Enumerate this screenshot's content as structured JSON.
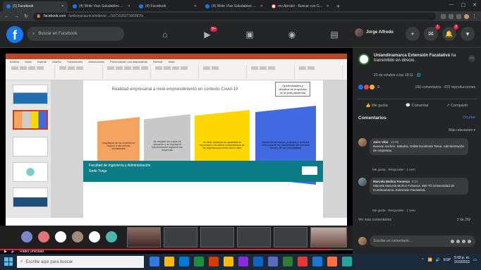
{
  "browser": {
    "tabs": [
      {
        "label": "(1) Facebook",
        "active": true
      },
      {
        "label": "(4) Write Vías Saludables Fa...",
        "active": false
      },
      {
        "label": "(4) Facebook",
        "active": false
      },
      {
        "label": "(4) Write Vías Saludables Fa...",
        "active": false
      },
      {
        "label": "rev.Aprobó - Buscar con Google",
        "active": false
      }
    ],
    "url_host": "facebook.com",
    "url_rest": "/uniboyacaunico/videos/..../1071535271669876/"
  },
  "fb": {
    "search_placeholder": "Buscar en Facebook",
    "watch_badge": "9+",
    "profile_name": "Jorge Alfredo",
    "notif_badge_1": "1",
    "notif_badge_2": "3"
  },
  "slide": {
    "ribbon_tabs": [
      "Archivo",
      "Inicio",
      "Insertar",
      "Diseño",
      "Transiciones",
      "Animaciones",
      "Presentación con diapositivas",
      "Revisar",
      "Vista"
    ],
    "title": "Realidad empresarial a nivel emprendimiento en contexto Covid-19",
    "note": "Oportunidades y desafíos de empresas en la post pandemia",
    "shapes": [
      {
        "text": "Adaptación de los modelos de negocio a las nuevas necesidades",
        "color": "#f4a460"
      },
      {
        "text": "Se reducen los costos de operación y se impulsa la transformación digital de las empresas",
        "color": "#c8c8c8"
      },
      {
        "text": "Se debe fortalecer la capacidad de innovación y la cultura emprendedora de las regiones para crear nuevo valor",
        "color": "#ffd700"
      },
      {
        "text": "Desarrollo de nuevos productos y servicios enfocados en las necesidades del mercado actual y de las comunidades",
        "color": "#4169e1"
      }
    ],
    "footer_line1": "Facultad de Ingeniería y Administración",
    "footer_line2": "Sede Tunja"
  },
  "meet": {
    "participants": [
      {
        "label": "",
        "color": "#7986cb"
      },
      {
        "label": "",
        "color": "#e57373"
      },
      {
        "label": "",
        "color": "#ffffff"
      },
      {
        "label": "",
        "color": "#a1887f"
      },
      {
        "label": "",
        "color": "#ffffff"
      },
      {
        "label": "",
        "color": "#4db6ac"
      }
    ],
    "tiles": [
      "",
      "",
      "",
      "",
      ""
    ]
  },
  "player": {
    "title": "Radio Unicidad"
  },
  "post": {
    "page_name": "Uniandinamarca Extensión",
    "page_sub": "Facatativá",
    "page_rest": "ha transmitido en directo.",
    "date": "23 de octubre a las 18:11 · 🌐",
    "reaction_count": "9",
    "comments_count": "150 comentarios · 872 reproducciones",
    "actions": [
      "Me gusta",
      "Comentar",
      "Compartir"
    ],
    "comments_heading": "Comentarios",
    "comments_link": "Ocultar",
    "sort_label": "Más relevantes ▾",
    "comments": [
      {
        "name": "Jairo Vilar",
        "time": "15:08",
        "text": "Buenas noches. Saludos. Doble Excelente Tema. Administración de empresas.",
        "meta": "Me gusta · Responder · 1 sem"
      },
      {
        "name": "Marcela Molina Fonseca",
        "time": "0:24",
        "text": "Marcela Marcela Muñoz Fonseca. 360 TO Universidad de Cundinamarca. Extensión Facatativá.",
        "meta": "Me gusta · Responder · 1 sem"
      }
    ],
    "more_comments": "Ver más comentarios",
    "pagination": "2 de 292",
    "write_placeholder": "Escribe un comentario..."
  },
  "taskbar": {
    "search_placeholder": "Escribe aquí para buscar",
    "apps": [
      "#2d7be5",
      "#ffb900",
      "#0078d7",
      "#1e8e3e",
      "#d83b01",
      "#ffb900",
      "#8a2be2",
      "#0a66c2",
      "#5c6bc0",
      "#2e7d32",
      "#e53935",
      "#1976d2",
      "#ff7043",
      "#26a69a"
    ],
    "time": "5:09 p. m.",
    "date": "2/10/2021",
    "lang": "ESP"
  }
}
